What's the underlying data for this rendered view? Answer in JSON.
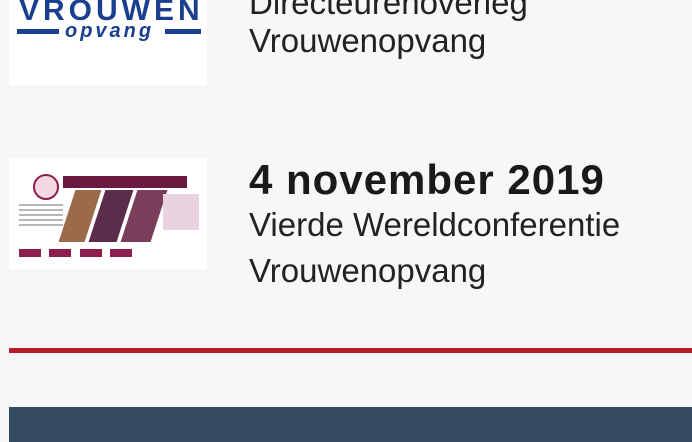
{
  "items": [
    {
      "date": "",
      "title_lines": [
        "Directeurenoverleg",
        "Vrouwenopvang"
      ],
      "logo": {
        "top_text": "VROUWEN",
        "bottom_text": "opvang"
      }
    },
    {
      "date": "4 november 2019",
      "title_lines": [
        "Vierde Wereldconferentie",
        "Vrouwenopvang"
      ]
    }
  ],
  "colors": {
    "divider": "#b81c24",
    "footer": "#344a5f",
    "logo_blue": "#1b3f8f"
  }
}
